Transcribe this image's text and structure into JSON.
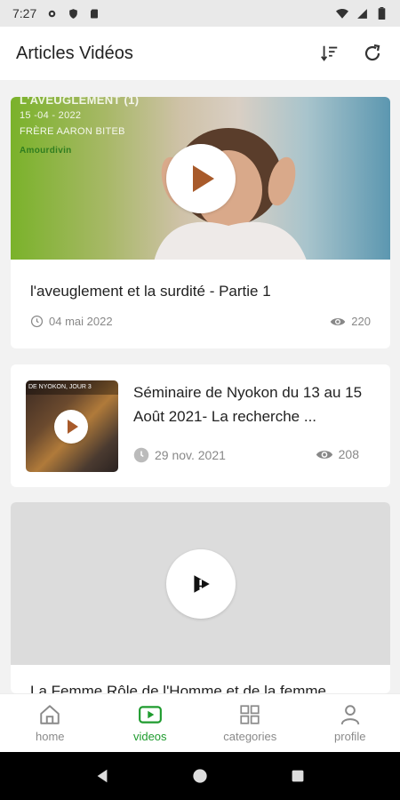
{
  "status_bar": {
    "time": "7:27"
  },
  "app_bar": {
    "title": "Articles Vidéos"
  },
  "videos": [
    {
      "title": "l'aveuglement et la surdité - Partie 1",
      "date": "04 mai 2022",
      "views": "220",
      "thumb_text": {
        "heading": "L'AVEUGLEMENT (1)",
        "date": "15 -04 - 2022",
        "author": "FRÈRE AARON BITEB",
        "brand": "Amourdivin"
      }
    },
    {
      "title": "Séminaire de Nyokon du 13 au 15 Août 2021- La recherche ...",
      "date": "29 nov. 2021",
      "views": "208",
      "thumb_text": {
        "strip": "DE NYOKON, JOUR 3"
      }
    },
    {
      "title": "La Femme Rôle de l'Homme et de la femme"
    }
  ],
  "bottom_nav": [
    {
      "label": "home",
      "icon": "home-icon",
      "active": false
    },
    {
      "label": "videos",
      "icon": "video-icon",
      "active": true
    },
    {
      "label": "categories",
      "icon": "grid-icon",
      "active": false
    },
    {
      "label": "profile",
      "icon": "person-icon",
      "active": false
    }
  ],
  "colors": {
    "accent": "#1e9b2e",
    "play": "#a85a2a",
    "muted": "#888888"
  }
}
